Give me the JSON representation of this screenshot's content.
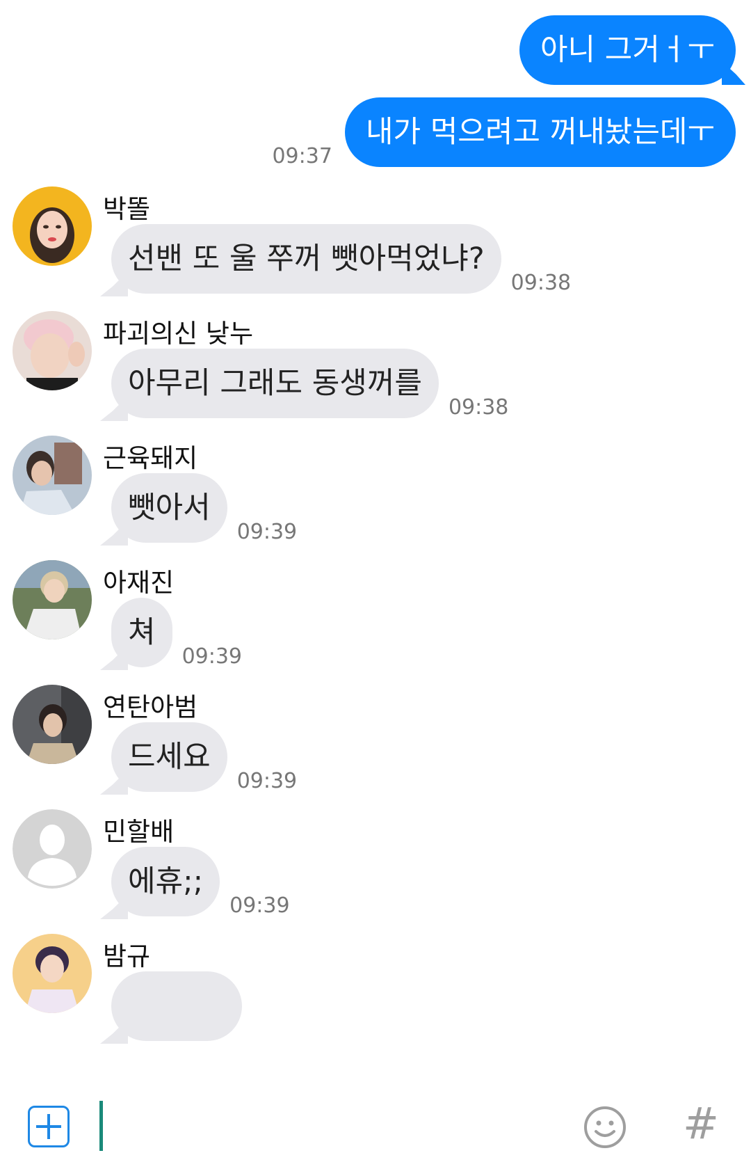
{
  "outgoing": {
    "messages": [
      "아니 그거ㅓㅜ",
      "내가 먹으려고 꺼내놨는데ㅜ"
    ],
    "time": "09:37"
  },
  "incoming": [
    {
      "sender": "박똘",
      "text": "선밴 또 울 쭈꺼 뺏아먹었냐?",
      "time": "09:38"
    },
    {
      "sender": "파괴의신 낮누",
      "text": "아무리 그래도 동생꺼를",
      "time": "09:38"
    },
    {
      "sender": "근육돼지",
      "text": "뺏아서",
      "time": "09:39"
    },
    {
      "sender": "아재진",
      "text": "쳐",
      "time": "09:39"
    },
    {
      "sender": "연탄아범",
      "text": "드세요",
      "time": "09:39"
    },
    {
      "sender": "민할배",
      "text": "에휴;;",
      "time": "09:39"
    },
    {
      "sender": "밤규",
      "text": "",
      "time": ""
    }
  ],
  "composer": {
    "add_icon": "plus-square-icon",
    "emoji_icon": "smiley-face-icon",
    "hashtag_label": "#",
    "input_value": ""
  },
  "colors": {
    "outgoing_bubble": "#0a84ff",
    "incoming_bubble": "#e8e8ec",
    "accent_blue": "#1e88e5",
    "cursor": "#1a8a7a"
  }
}
